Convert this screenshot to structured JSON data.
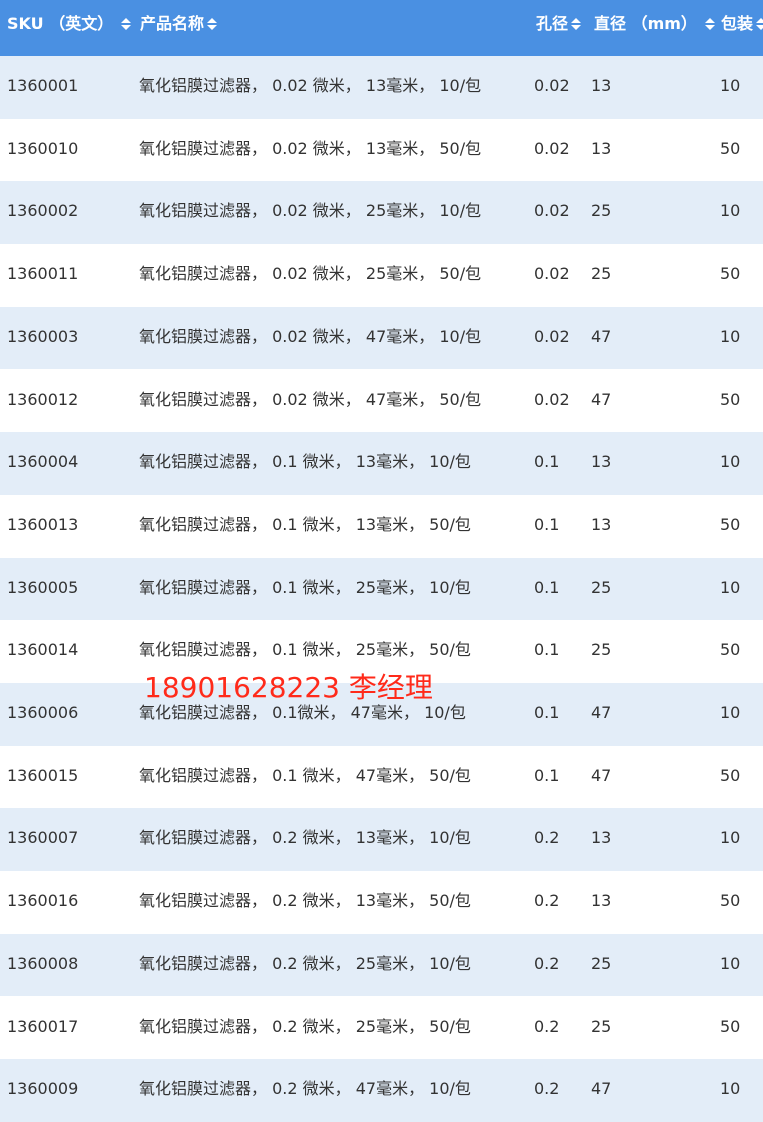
{
  "header": {
    "sku": "SKU （英文）",
    "name": "产品名称",
    "pore": "孔径",
    "diameter": "直径 （mm）",
    "pack": "包装"
  },
  "rows": [
    {
      "sku": "1360001",
      "name": "氧化铝膜过滤器， 0.02 微米， 13毫米， 10/包",
      "pore": "0.02",
      "diameter": "13",
      "pack": "10"
    },
    {
      "sku": "1360010",
      "name": "氧化铝膜过滤器， 0.02 微米， 13毫米， 50/包",
      "pore": "0.02",
      "diameter": "13",
      "pack": "50"
    },
    {
      "sku": "1360002",
      "name": "氧化铝膜过滤器， 0.02 微米， 25毫米， 10/包",
      "pore": "0.02",
      "diameter": "25",
      "pack": "10"
    },
    {
      "sku": "1360011",
      "name": "氧化铝膜过滤器， 0.02 微米， 25毫米， 50/包",
      "pore": "0.02",
      "diameter": "25",
      "pack": "50"
    },
    {
      "sku": "1360003",
      "name": "氧化铝膜过滤器， 0.02 微米， 47毫米， 10/包",
      "pore": "0.02",
      "diameter": "47",
      "pack": "10"
    },
    {
      "sku": "1360012",
      "name": "氧化铝膜过滤器， 0.02 微米， 47毫米， 50/包",
      "pore": "0.02",
      "diameter": "47",
      "pack": "50"
    },
    {
      "sku": "1360004",
      "name": "氧化铝膜过滤器， 0.1 微米， 13毫米， 10/包",
      "pore": "0.1",
      "diameter": "13",
      "pack": "10"
    },
    {
      "sku": "1360013",
      "name": "氧化铝膜过滤器， 0.1 微米， 13毫米， 50/包",
      "pore": "0.1",
      "diameter": "13",
      "pack": "50"
    },
    {
      "sku": "1360005",
      "name": "氧化铝膜过滤器， 0.1 微米， 25毫米， 10/包",
      "pore": "0.1",
      "diameter": "25",
      "pack": "10"
    },
    {
      "sku": "1360014",
      "name": "氧化铝膜过滤器， 0.1 微米， 25毫米， 50/包",
      "pore": "0.1",
      "diameter": "25",
      "pack": "50"
    },
    {
      "sku": "1360006",
      "name": "氧化铝膜过滤器， 0.1微米， 47毫米， 10/包",
      "pore": "0.1",
      "diameter": "47",
      "pack": "10"
    },
    {
      "sku": "1360015",
      "name": "氧化铝膜过滤器， 0.1 微米， 47毫米， 50/包",
      "pore": "0.1",
      "diameter": "47",
      "pack": "50"
    },
    {
      "sku": "1360007",
      "name": "氧化铝膜过滤器， 0.2 微米， 13毫米， 10/包",
      "pore": "0.2",
      "diameter": "13",
      "pack": "10"
    },
    {
      "sku": "1360016",
      "name": "氧化铝膜过滤器， 0.2 微米， 13毫米， 50/包",
      "pore": "0.2",
      "diameter": "13",
      "pack": "50"
    },
    {
      "sku": "1360008",
      "name": "氧化铝膜过滤器， 0.2 微米， 25毫米， 10/包",
      "pore": "0.2",
      "diameter": "25",
      "pack": "10"
    },
    {
      "sku": "1360017",
      "name": "氧化铝膜过滤器， 0.2 微米， 25毫米， 50/包",
      "pore": "0.2",
      "diameter": "25",
      "pack": "50"
    },
    {
      "sku": "1360009",
      "name": "氧化铝膜过滤器， 0.2 微米， 47毫米， 10/包",
      "pore": "0.2",
      "diameter": "47",
      "pack": "10"
    }
  ],
  "contact": "18901628223 李经理",
  "colors": {
    "header_bg": "#4a90e2",
    "row_alt_bg": "#e3edf8",
    "contact_text": "#ff2a1a"
  },
  "icons": {
    "sort": "sort-arrows-icon"
  }
}
